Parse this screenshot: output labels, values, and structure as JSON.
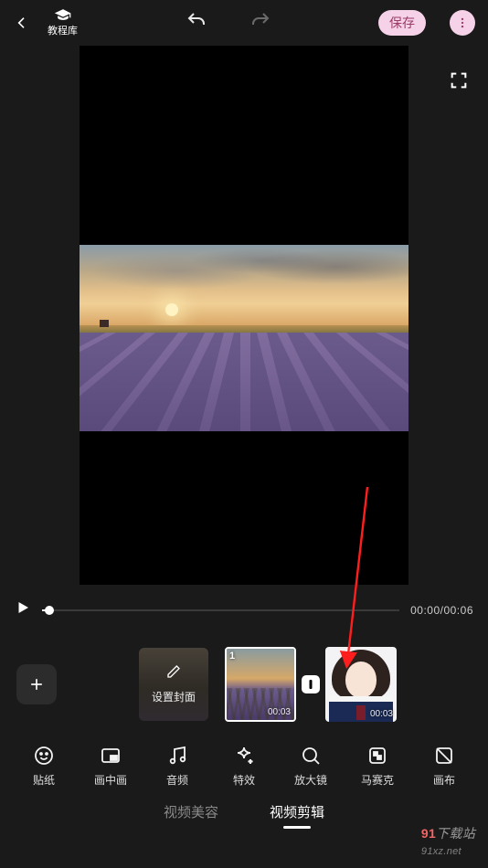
{
  "topbar": {
    "tutorial_label": "教程库",
    "save_label": "保存"
  },
  "playback": {
    "time_display": "00:00/00:06"
  },
  "timeline": {
    "cover_label": "设置封面",
    "clips": [
      {
        "index": "1",
        "duration": "00:03"
      },
      {
        "index": "",
        "duration": "00:03"
      }
    ]
  },
  "tools": [
    {
      "key": "sticker",
      "label": "贴纸"
    },
    {
      "key": "pip",
      "label": "画中画"
    },
    {
      "key": "audio",
      "label": "音频"
    },
    {
      "key": "effects",
      "label": "特效"
    },
    {
      "key": "magnify",
      "label": "放大镜"
    },
    {
      "key": "mosaic",
      "label": "马赛克"
    },
    {
      "key": "canvas",
      "label": "画布"
    }
  ],
  "tabs": {
    "beauty": "视频美容",
    "edit": "视频剪辑"
  },
  "watermark": {
    "brand": "91",
    "text": "下载站",
    "url_suffix": "91xz.net"
  }
}
